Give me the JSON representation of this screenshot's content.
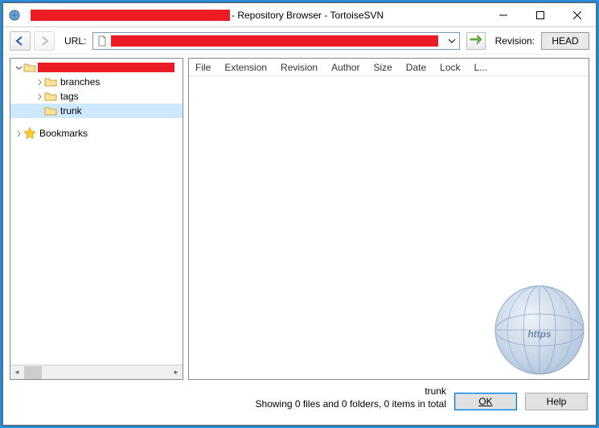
{
  "title": " - Repository Browser - TortoiseSVN",
  "toolbar": {
    "url_label": "URL:",
    "revision_label": "Revision:",
    "head_label": "HEAD"
  },
  "tree": {
    "items": [
      {
        "label": "branches"
      },
      {
        "label": "tags"
      },
      {
        "label": "trunk"
      }
    ],
    "bookmarks_label": "Bookmarks"
  },
  "list": {
    "columns": [
      "File",
      "Extension",
      "Revision",
      "Author",
      "Size",
      "Date",
      "Lock",
      "L..."
    ]
  },
  "status": {
    "path": "trunk",
    "summary": "Showing 0 files and 0 folders, 0 items in total"
  },
  "buttons": {
    "ok": "OK",
    "help": "Help"
  },
  "watermark_text": "https"
}
